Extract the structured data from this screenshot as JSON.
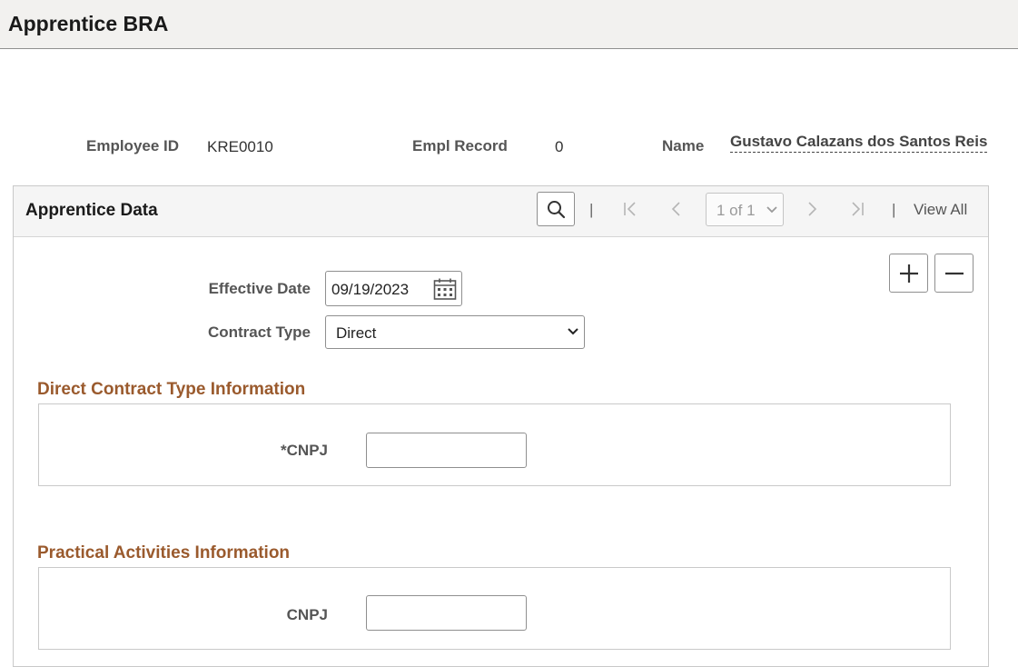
{
  "page": {
    "title": "Apprentice BRA"
  },
  "employee": {
    "id_label": "Employee ID",
    "id_value": "KRE0010",
    "record_label": "Empl Record",
    "record_value": "0",
    "name_label": "Name",
    "name_value": "Gustavo Calazans dos Santos Reis"
  },
  "panel": {
    "title": "Apprentice Data",
    "pager": {
      "separator": "|",
      "current": "1 of 1",
      "view_all": "View All"
    },
    "icons": [
      "search-icon",
      "first-page-icon",
      "previous-page-icon",
      "chevron-down-icon",
      "next-page-icon",
      "last-page-icon",
      "add-icon",
      "remove-icon",
      "calendar-icon"
    ]
  },
  "form": {
    "effective_date_label": "Effective Date",
    "effective_date_value": "09/19/2023",
    "contract_type_label": "Contract Type",
    "contract_type_value": "Direct"
  },
  "sections": {
    "direct": {
      "title": "Direct Contract Type Information",
      "cnpj_label": "*CNPJ",
      "cnpj_value": ""
    },
    "practical": {
      "title": "Practical Activities Information",
      "cnpj_label": "CNPJ",
      "cnpj_value": ""
    }
  },
  "colors": {
    "section_title": "#9a5a2d",
    "header_bg": "#f2f1ef"
  }
}
